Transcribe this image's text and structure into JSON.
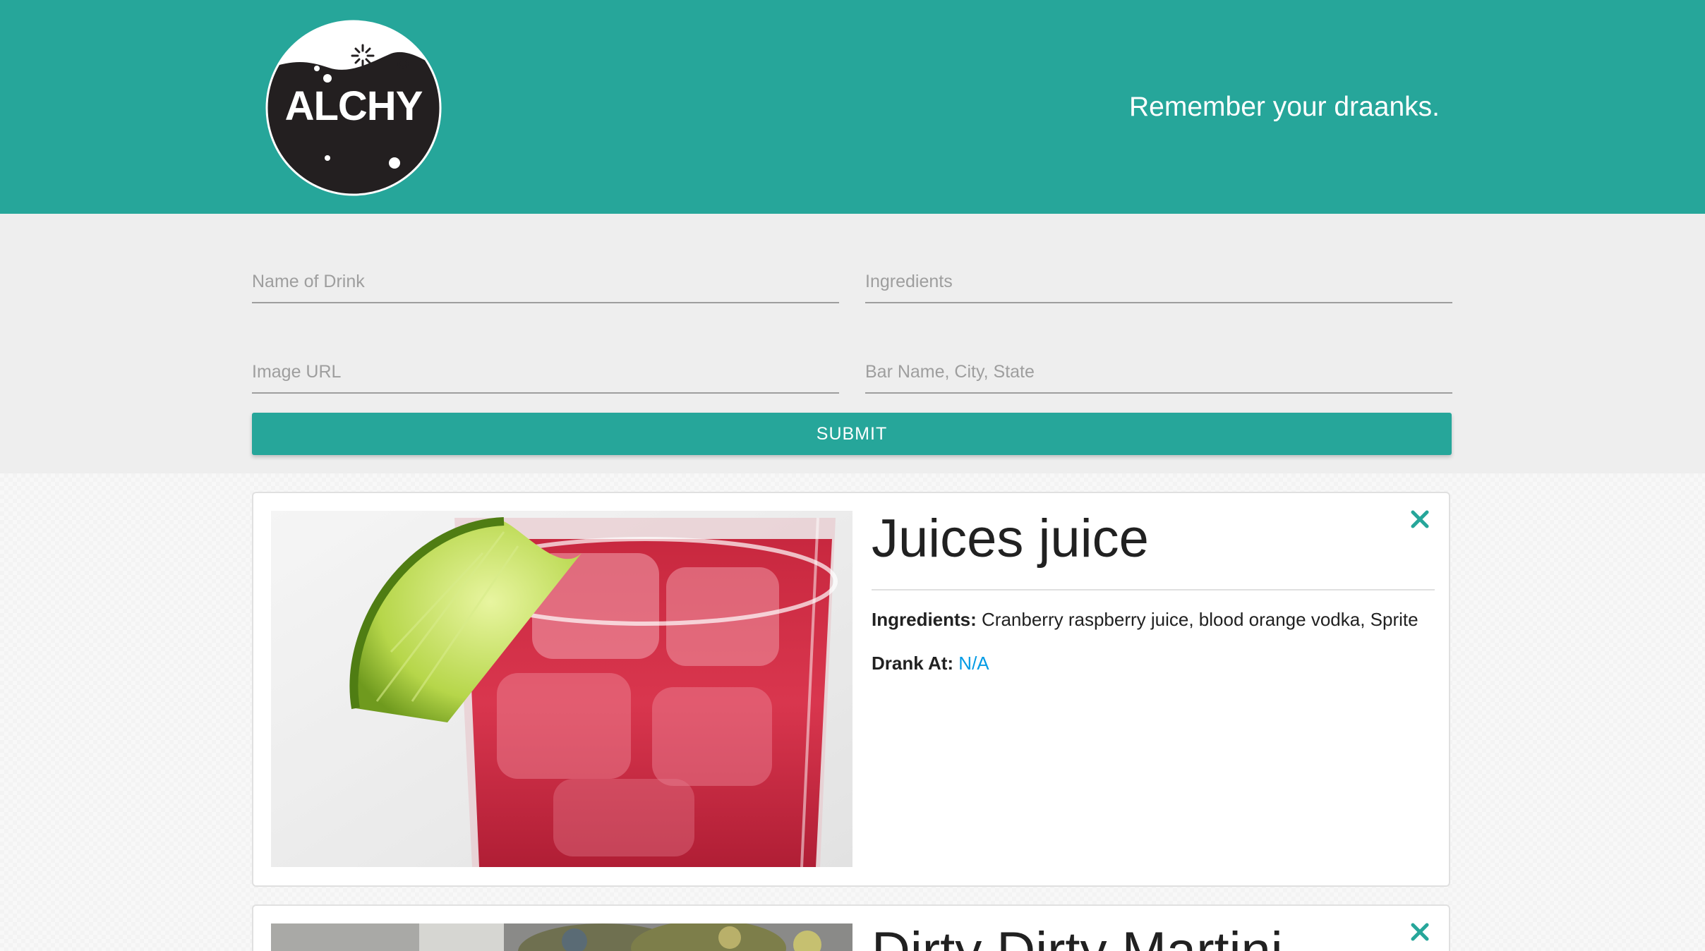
{
  "header": {
    "logo_text": "ALCHY",
    "tagline": "Remember your draanks.",
    "color": "#26a69a"
  },
  "form": {
    "name_placeholder": "Name of Drink",
    "ingredients_placeholder": "Ingredients",
    "image_placeholder": "Image URL",
    "bar_placeholder": "Bar Name, City, State",
    "submit_label": "SUBMIT"
  },
  "drinks": [
    {
      "title": "Juices juice",
      "ingredients_label": "Ingredients:",
      "ingredients": "Cranberry raspberry juice, blood orange vodka, Sprite",
      "drank_label": "Drank At:",
      "drank_at": "N/A",
      "close_icon": "close-icon"
    },
    {
      "title": "Dirty Dirty Martini",
      "close_icon": "close-icon"
    }
  ],
  "colors": {
    "accent": "#26a69a",
    "link": "#039be5",
    "form_bg": "#eeeeee"
  }
}
